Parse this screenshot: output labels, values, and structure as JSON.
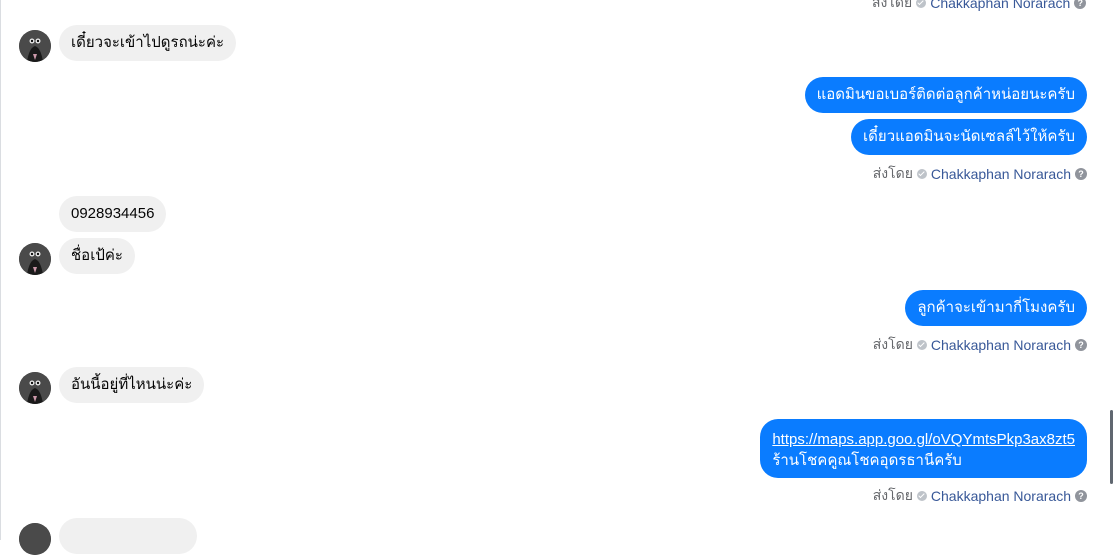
{
  "sender": {
    "label": "ส่งโดย",
    "name": "Chakkaphan Norarach"
  },
  "messages": {
    "in_1": "เดี๋ยวจะเข้าไปดูรถน่ะค่ะ",
    "out_1": "แอดมินขอเบอร์ติดต่อลูกค้าหน่อยนะครับ",
    "out_2": "เดี๋ยวแอดมินจะนัดเซลล์ไว้ให้ครับ",
    "in_2": "0928934456",
    "in_3": "ชื่อเป้ค่ะ",
    "out_3": "ลูกค้าจะเข้ามากี่โมงครับ",
    "in_4": "อันนี้อยู่ที่ไหนน่ะค่ะ",
    "out_4_link": "https://maps.app.goo.gl/oVQYmtsPkp3ax8zt5",
    "out_4_text": "ร้านโชคคูณโชคอุดรธานีครับ"
  },
  "icons": {
    "verified": "check-circle-icon",
    "help": "question-circle-icon",
    "avatar": "contact-avatar"
  }
}
